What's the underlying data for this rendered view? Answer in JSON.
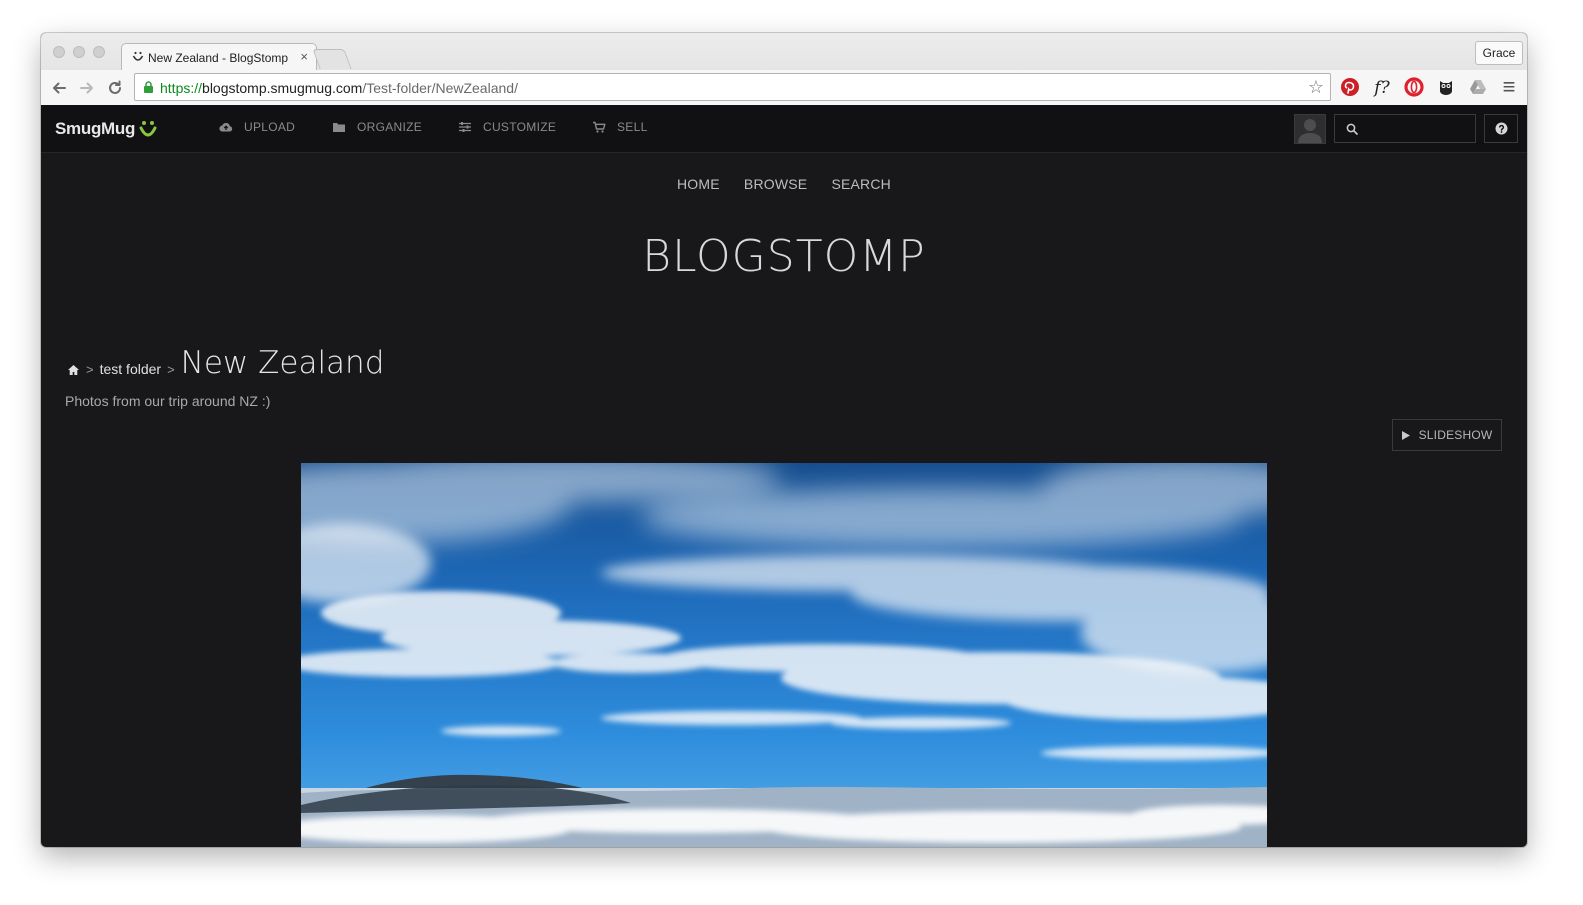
{
  "browser": {
    "tab_title": "New Zealand - BlogStomp",
    "tab_close": "×",
    "profile_name": "Grace",
    "url_scheme": "https://",
    "url_host": "blogstomp.smugmug.com",
    "url_path": "/Test-folder/NewZealand/",
    "extensions": [
      "pinterest-icon",
      "whatfont-icon",
      "opera-icon",
      "hootsuite-icon",
      "google-drive-icon"
    ],
    "whatfont_label": "f?",
    "menu_glyph": "≡",
    "bookmark_star": "☆"
  },
  "smugmug_bar": {
    "logo_text": "SmugMug",
    "nav": [
      {
        "label": "UPLOAD",
        "icon": "cloud-upload-icon"
      },
      {
        "label": "ORGANIZE",
        "icon": "folder-icon"
      },
      {
        "label": "CUSTOMIZE",
        "icon": "sliders-icon"
      },
      {
        "label": "SELL",
        "icon": "cart-icon"
      }
    ],
    "search_placeholder": ""
  },
  "site": {
    "nav": [
      "HOME",
      "BROWSE",
      "SEARCH"
    ],
    "title": "BLOGSTOMP"
  },
  "breadcrumb": {
    "folder": "test folder",
    "current": "New Zealand",
    "separator": ">"
  },
  "gallery": {
    "description": "Photos from our trip around NZ :)",
    "slideshow_label": "SLIDESHOW"
  },
  "colors": {
    "page_bg": "#18181a",
    "topbar_bg": "#111113",
    "logo_accent": "#8cc63f",
    "secure_green": "#0b8a1e"
  }
}
